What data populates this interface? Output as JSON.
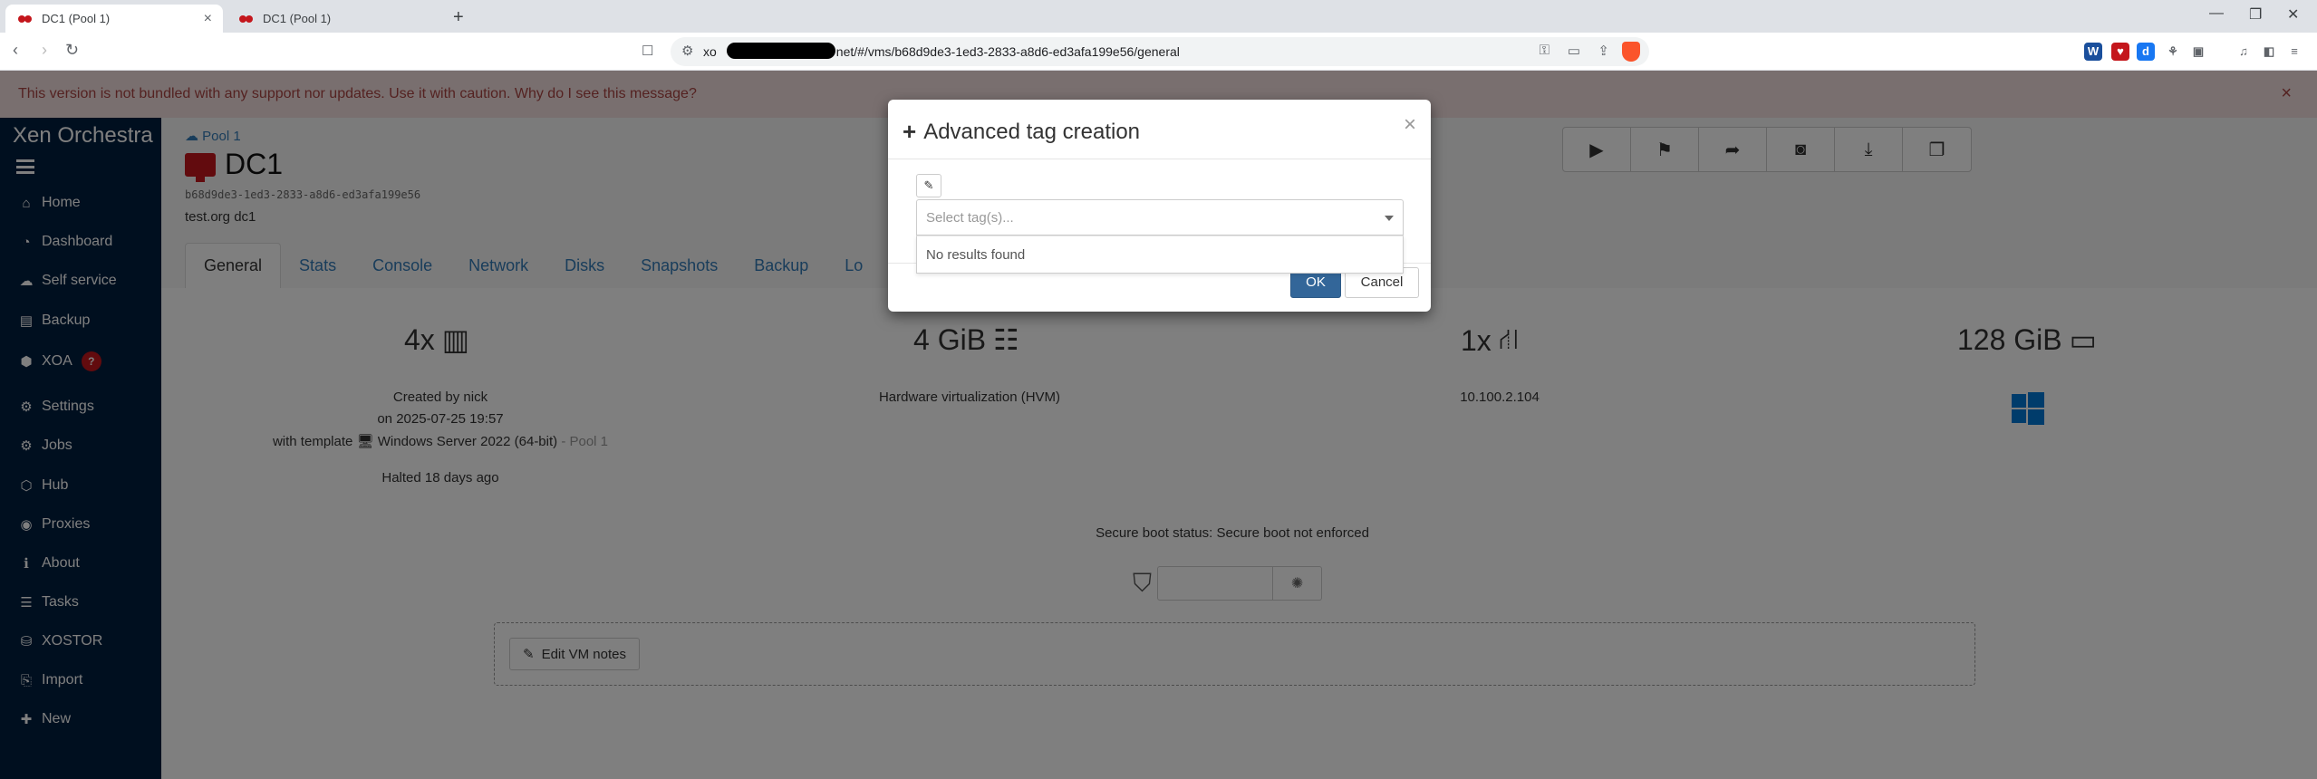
{
  "browser": {
    "tabs": [
      {
        "title": "DC1 (Pool 1)",
        "active": true
      },
      {
        "title": "DC1 (Pool 1)",
        "active": false
      }
    ],
    "url_prefix": "xo",
    "url_suffix": "net/#/vms/b68d9de3-1ed3-2833-a8d6-ed3afa199e56/general"
  },
  "banner": {
    "text": "This version is not bundled with any support nor updates. Use it with caution. Why do I see this message?"
  },
  "sidebar": {
    "brand": "Xen Orchestra",
    "items": [
      {
        "label": "Home",
        "icon": "home-icon"
      },
      {
        "label": "Dashboard",
        "icon": "dashboard-icon"
      },
      {
        "label": "Self service",
        "icon": "cloud-icon"
      },
      {
        "label": "Backup",
        "icon": "archive-icon"
      },
      {
        "label": "XOA",
        "icon": "cube-icon",
        "badge": "?"
      },
      {
        "label": "Settings",
        "icon": "gear-icon"
      },
      {
        "label": "Jobs",
        "icon": "gears-icon"
      },
      {
        "label": "Hub",
        "icon": "cubes-icon"
      },
      {
        "label": "Proxies",
        "icon": "globe-icon"
      },
      {
        "label": "About",
        "icon": "info-icon"
      },
      {
        "label": "Tasks",
        "icon": "tasks-icon"
      },
      {
        "label": "XOSTOR",
        "icon": "database-icon"
      },
      {
        "label": "Import",
        "icon": "import-icon"
      },
      {
        "label": "New",
        "icon": "plus-icon"
      }
    ]
  },
  "vm": {
    "pool": "Pool 1",
    "name": "DC1",
    "uuid": "b68d9de3-1ed3-2833-a8d6-ed3afa199e56",
    "description": "test.org dc1",
    "tabs": [
      "General",
      "Stats",
      "Console",
      "Network",
      "Disks",
      "Snapshots",
      "Backup",
      "Lo"
    ]
  },
  "stats": {
    "cpus": "4x",
    "memory": "4 GiB",
    "networks": "1x",
    "storage": "128 GiB",
    "created_by": "Created by nick",
    "created_on": "on 2025-07-25 19:57",
    "template_prefix": "with template",
    "template_name": "Windows Server 2022 (64-bit)",
    "template_pool": "- Pool 1",
    "halted": "Halted 18 days ago",
    "virtualization": "Hardware virtualization (HVM)",
    "ip": "10.100.2.104",
    "secure_boot": "Secure boot status: Secure boot not enforced"
  },
  "notes": {
    "button": "Edit VM notes"
  },
  "modal": {
    "title": "Advanced tag creation",
    "placeholder": "Select tag(s)...",
    "no_results": "No results found",
    "ok": "OK",
    "cancel": "Cancel"
  }
}
